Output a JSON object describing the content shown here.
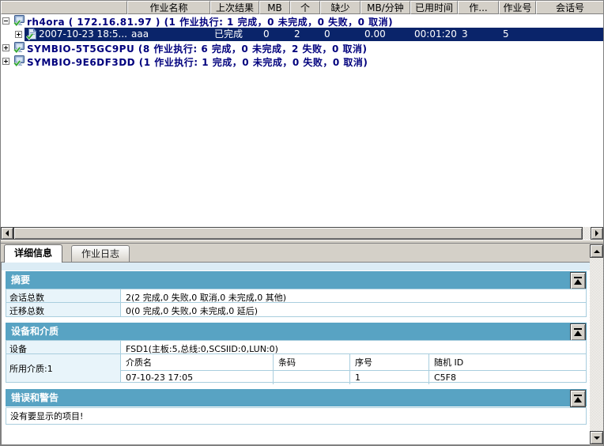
{
  "colors": {
    "accent_teal": "#58a3c3",
    "selection_navy": "#0a246a",
    "tree_text_navy": "#00007d",
    "chrome_gray": "#d4d0c8",
    "light_blue_cell": "#e8f4fa"
  },
  "job_table": {
    "columns": [
      {
        "label": ""
      },
      {
        "label": "作业名称"
      },
      {
        "label": "上次结果"
      },
      {
        "label": "MB"
      },
      {
        "label": "个"
      },
      {
        "label": "缺少"
      },
      {
        "label": "MB/分钟"
      },
      {
        "label": "已用时间"
      },
      {
        "label": "作..."
      },
      {
        "label": "作业号"
      },
      {
        "label": "会话号"
      }
    ],
    "rows": [
      {
        "type": "group",
        "text": "rh4ora ( 172.16.81.97 )  (1 作业执行: 1 完成，0 未完成，0 失败，0 取消)"
      },
      {
        "type": "job",
        "name": "2007-10-23 18:5...",
        "cells": [
          "aaa",
          "已完成",
          "0",
          "2",
          "0",
          "0.00",
          "00:01:20",
          "3",
          "5",
          ""
        ]
      },
      {
        "type": "group",
        "text": "SYMBIO-5T5GC9PU (8 作业执行: 6 完成，0 未完成，2 失败，0 取消)"
      },
      {
        "type": "group",
        "text": "SYMBIO-9E6DF3DD (1 作业执行: 1 完成，0 未完成，0 失败，0 取消)"
      }
    ]
  },
  "tabs": [
    {
      "label": "详细信息"
    },
    {
      "label": "作业日志"
    }
  ],
  "details": {
    "summary": {
      "title": "摘要",
      "rows": [
        {
          "label": "会话总数",
          "value": "2(2 完成,0 失败,0 取消,0 未完成,0 其他)"
        },
        {
          "label": "迁移总数",
          "value": "0(0 完成,0 失败,0 未完成,0 延后)"
        }
      ]
    },
    "devices": {
      "title": "设备和介质",
      "device_label": "设备",
      "device_value": "FSD1(主板:5,总线:0,SCSIID:0,LUN:0)",
      "media_label": "所用介质:1",
      "media_columns": [
        "介质名",
        "条码",
        "序号",
        "随机 ID"
      ],
      "media_rows": [
        [
          "07-10-23 17:05",
          "",
          "1",
          "C5F8"
        ]
      ]
    },
    "errors": {
      "title": "错误和警告",
      "empty_text": "没有要显示的项目!"
    }
  }
}
